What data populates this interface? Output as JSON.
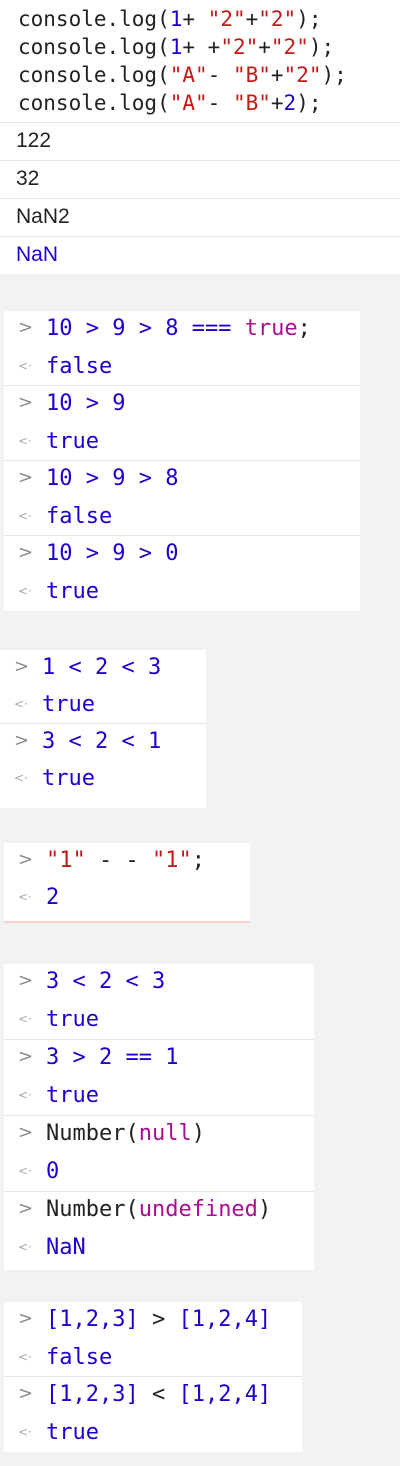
{
  "colors": {
    "number": "#1c00cf",
    "string": "#c41a16",
    "keyword": "#aa0d91",
    "plain": "#222222",
    "arrow": "#8a8a8a"
  },
  "icons": {
    "input_prompt": "chevron-right-icon",
    "output_result": "return-arrow-icon"
  },
  "prompt_glyph": ">",
  "result_glyph": "<·",
  "panel1": {
    "code_lines": [
      [
        {
          "t": "console.log(",
          "c": "plain"
        },
        {
          "t": "1",
          "c": "num"
        },
        {
          "t": "+ ",
          "c": "plain"
        },
        {
          "t": "\"2\"",
          "c": "str"
        },
        {
          "t": "+",
          "c": "plain"
        },
        {
          "t": "\"2\"",
          "c": "str"
        },
        {
          "t": ");",
          "c": "plain"
        }
      ],
      [
        {
          "t": "console.log(",
          "c": "plain"
        },
        {
          "t": "1",
          "c": "num"
        },
        {
          "t": "+ +",
          "c": "plain"
        },
        {
          "t": "\"2\"",
          "c": "str"
        },
        {
          "t": "+",
          "c": "plain"
        },
        {
          "t": "\"2\"",
          "c": "str"
        },
        {
          "t": ");",
          "c": "plain"
        }
      ],
      [
        {
          "t": "console.log(",
          "c": "plain"
        },
        {
          "t": "\"A\"",
          "c": "str"
        },
        {
          "t": "- ",
          "c": "plain"
        },
        {
          "t": "\"B\"",
          "c": "str"
        },
        {
          "t": "+",
          "c": "plain"
        },
        {
          "t": "\"2\"",
          "c": "str"
        },
        {
          "t": ");",
          "c": "plain"
        }
      ],
      [
        {
          "t": "console.log(",
          "c": "plain"
        },
        {
          "t": "\"A\"",
          "c": "str"
        },
        {
          "t": "- ",
          "c": "plain"
        },
        {
          "t": "\"B\"",
          "c": "str"
        },
        {
          "t": "+",
          "c": "plain"
        },
        {
          "t": "2",
          "c": "num"
        },
        {
          "t": ");",
          "c": "plain"
        }
      ]
    ],
    "outputs": [
      {
        "text": "122",
        "c": "plain"
      },
      {
        "text": "32",
        "c": "plain"
      },
      {
        "text": "NaN2",
        "c": "plain"
      },
      {
        "text": "NaN",
        "c": "num"
      }
    ]
  },
  "panel2": [
    {
      "kind": "in",
      "tokens": [
        {
          "t": "10 > 9 > 8 === ",
          "c": "num"
        },
        {
          "t": "true",
          "c": "kw"
        },
        {
          "t": ";",
          "c": "plain"
        }
      ]
    },
    {
      "kind": "out",
      "tokens": [
        {
          "t": "false",
          "c": "num"
        }
      ]
    },
    {
      "kind": "in",
      "tokens": [
        {
          "t": "10 > 9",
          "c": "num"
        }
      ]
    },
    {
      "kind": "out",
      "tokens": [
        {
          "t": "true",
          "c": "num"
        }
      ]
    },
    {
      "kind": "in",
      "tokens": [
        {
          "t": "10 > 9 > 8",
          "c": "num"
        }
      ]
    },
    {
      "kind": "out",
      "tokens": [
        {
          "t": "false",
          "c": "num"
        }
      ]
    },
    {
      "kind": "in",
      "tokens": [
        {
          "t": "10 > 9 > 0",
          "c": "num"
        }
      ]
    },
    {
      "kind": "out",
      "tokens": [
        {
          "t": "true",
          "c": "num"
        }
      ]
    }
  ],
  "panel3": [
    {
      "kind": "in",
      "tokens": [
        {
          "t": "1 < 2 < 3",
          "c": "num"
        }
      ]
    },
    {
      "kind": "out",
      "tokens": [
        {
          "t": "true",
          "c": "num"
        }
      ]
    },
    {
      "kind": "in",
      "tokens": [
        {
          "t": "3 < 2 < 1",
          "c": "num"
        }
      ]
    },
    {
      "kind": "out",
      "tokens": [
        {
          "t": "true",
          "c": "num"
        }
      ]
    }
  ],
  "panel4": [
    {
      "kind": "in",
      "tokens": [
        {
          "t": "\"1\"",
          "c": "str"
        },
        {
          "t": " - - ",
          "c": "plain"
        },
        {
          "t": "\"1\"",
          "c": "str"
        },
        {
          "t": ";",
          "c": "plain"
        }
      ]
    },
    {
      "kind": "out",
      "tokens": [
        {
          "t": "2",
          "c": "num"
        }
      ]
    }
  ],
  "panel5": [
    {
      "kind": "in",
      "tokens": [
        {
          "t": "3 < 2 < 3",
          "c": "num"
        }
      ]
    },
    {
      "kind": "out",
      "tokens": [
        {
          "t": "true",
          "c": "num"
        }
      ]
    },
    {
      "kind": "in",
      "tokens": [
        {
          "t": "3 > 2 == 1",
          "c": "num"
        }
      ]
    },
    {
      "kind": "out",
      "tokens": [
        {
          "t": "true",
          "c": "num"
        }
      ]
    },
    {
      "kind": "in",
      "tokens": [
        {
          "t": "Number(",
          "c": "plain"
        },
        {
          "t": "null",
          "c": "kw"
        },
        {
          "t": ")",
          "c": "plain"
        }
      ]
    },
    {
      "kind": "out",
      "tokens": [
        {
          "t": "0",
          "c": "num"
        }
      ]
    },
    {
      "kind": "in",
      "tokens": [
        {
          "t": "Number(",
          "c": "plain"
        },
        {
          "t": "undefined",
          "c": "kw"
        },
        {
          "t": ")",
          "c": "plain"
        }
      ]
    },
    {
      "kind": "out",
      "tokens": [
        {
          "t": "NaN",
          "c": "num"
        }
      ]
    }
  ],
  "panel6": [
    {
      "kind": "in",
      "tokens": [
        {
          "t": "[1,2,3] ",
          "c": "num"
        },
        {
          "t": ">",
          "c": "plain"
        },
        {
          "t": " [1,2,4]",
          "c": "num"
        }
      ]
    },
    {
      "kind": "out",
      "tokens": [
        {
          "t": "false",
          "c": "num"
        }
      ]
    },
    {
      "kind": "in",
      "tokens": [
        {
          "t": "[1,2,3] ",
          "c": "num"
        },
        {
          "t": "<",
          "c": "plain"
        },
        {
          "t": " [1,2,4]",
          "c": "num"
        }
      ]
    },
    {
      "kind": "out",
      "tokens": [
        {
          "t": "true",
          "c": "num"
        }
      ]
    }
  ]
}
